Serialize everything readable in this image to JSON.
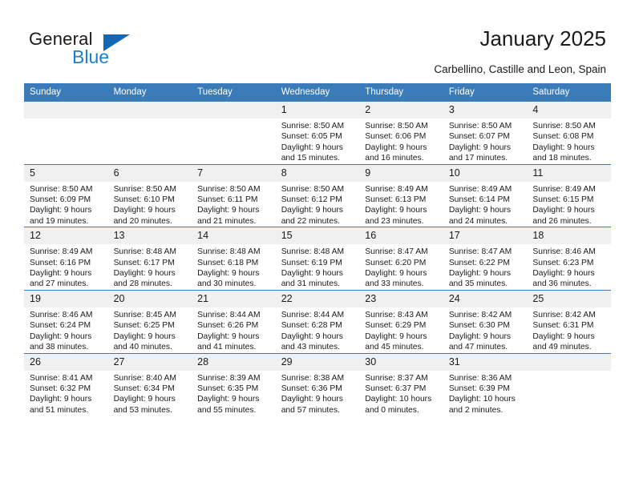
{
  "brand": {
    "name_part1": "General",
    "name_part2": "Blue",
    "triangle_color": "#1268b3",
    "blue_color": "#1a7fd4"
  },
  "header": {
    "title": "January 2025",
    "subtitle": "Carbellino, Castille and Leon, Spain",
    "header_bg": "#3a7cb9",
    "daynum_bg": "#f0f0f0"
  },
  "weekdays": [
    "Sunday",
    "Monday",
    "Tuesday",
    "Wednesday",
    "Thursday",
    "Friday",
    "Saturday"
  ],
  "weeks": [
    [
      {
        "day": "",
        "empty": true,
        "sunrise": "",
        "sunset": "",
        "daylight1": "",
        "daylight2": ""
      },
      {
        "day": "",
        "empty": true,
        "sunrise": "",
        "sunset": "",
        "daylight1": "",
        "daylight2": ""
      },
      {
        "day": "",
        "empty": true,
        "sunrise": "",
        "sunset": "",
        "daylight1": "",
        "daylight2": ""
      },
      {
        "day": "1",
        "empty": false,
        "sunrise": "Sunrise: 8:50 AM",
        "sunset": "Sunset: 6:05 PM",
        "daylight1": "Daylight: 9 hours",
        "daylight2": "and 15 minutes."
      },
      {
        "day": "2",
        "empty": false,
        "sunrise": "Sunrise: 8:50 AM",
        "sunset": "Sunset: 6:06 PM",
        "daylight1": "Daylight: 9 hours",
        "daylight2": "and 16 minutes."
      },
      {
        "day": "3",
        "empty": false,
        "sunrise": "Sunrise: 8:50 AM",
        "sunset": "Sunset: 6:07 PM",
        "daylight1": "Daylight: 9 hours",
        "daylight2": "and 17 minutes."
      },
      {
        "day": "4",
        "empty": false,
        "sunrise": "Sunrise: 8:50 AM",
        "sunset": "Sunset: 6:08 PM",
        "daylight1": "Daylight: 9 hours",
        "daylight2": "and 18 minutes."
      }
    ],
    [
      {
        "day": "5",
        "empty": false,
        "sunrise": "Sunrise: 8:50 AM",
        "sunset": "Sunset: 6:09 PM",
        "daylight1": "Daylight: 9 hours",
        "daylight2": "and 19 minutes."
      },
      {
        "day": "6",
        "empty": false,
        "sunrise": "Sunrise: 8:50 AM",
        "sunset": "Sunset: 6:10 PM",
        "daylight1": "Daylight: 9 hours",
        "daylight2": "and 20 minutes."
      },
      {
        "day": "7",
        "empty": false,
        "sunrise": "Sunrise: 8:50 AM",
        "sunset": "Sunset: 6:11 PM",
        "daylight1": "Daylight: 9 hours",
        "daylight2": "and 21 minutes."
      },
      {
        "day": "8",
        "empty": false,
        "sunrise": "Sunrise: 8:50 AM",
        "sunset": "Sunset: 6:12 PM",
        "daylight1": "Daylight: 9 hours",
        "daylight2": "and 22 minutes."
      },
      {
        "day": "9",
        "empty": false,
        "sunrise": "Sunrise: 8:49 AM",
        "sunset": "Sunset: 6:13 PM",
        "daylight1": "Daylight: 9 hours",
        "daylight2": "and 23 minutes."
      },
      {
        "day": "10",
        "empty": false,
        "sunrise": "Sunrise: 8:49 AM",
        "sunset": "Sunset: 6:14 PM",
        "daylight1": "Daylight: 9 hours",
        "daylight2": "and 24 minutes."
      },
      {
        "day": "11",
        "empty": false,
        "sunrise": "Sunrise: 8:49 AM",
        "sunset": "Sunset: 6:15 PM",
        "daylight1": "Daylight: 9 hours",
        "daylight2": "and 26 minutes."
      }
    ],
    [
      {
        "day": "12",
        "empty": false,
        "sunrise": "Sunrise: 8:49 AM",
        "sunset": "Sunset: 6:16 PM",
        "daylight1": "Daylight: 9 hours",
        "daylight2": "and 27 minutes."
      },
      {
        "day": "13",
        "empty": false,
        "sunrise": "Sunrise: 8:48 AM",
        "sunset": "Sunset: 6:17 PM",
        "daylight1": "Daylight: 9 hours",
        "daylight2": "and 28 minutes."
      },
      {
        "day": "14",
        "empty": false,
        "sunrise": "Sunrise: 8:48 AM",
        "sunset": "Sunset: 6:18 PM",
        "daylight1": "Daylight: 9 hours",
        "daylight2": "and 30 minutes."
      },
      {
        "day": "15",
        "empty": false,
        "sunrise": "Sunrise: 8:48 AM",
        "sunset": "Sunset: 6:19 PM",
        "daylight1": "Daylight: 9 hours",
        "daylight2": "and 31 minutes."
      },
      {
        "day": "16",
        "empty": false,
        "sunrise": "Sunrise: 8:47 AM",
        "sunset": "Sunset: 6:20 PM",
        "daylight1": "Daylight: 9 hours",
        "daylight2": "and 33 minutes."
      },
      {
        "day": "17",
        "empty": false,
        "sunrise": "Sunrise: 8:47 AM",
        "sunset": "Sunset: 6:22 PM",
        "daylight1": "Daylight: 9 hours",
        "daylight2": "and 35 minutes."
      },
      {
        "day": "18",
        "empty": false,
        "sunrise": "Sunrise: 8:46 AM",
        "sunset": "Sunset: 6:23 PM",
        "daylight1": "Daylight: 9 hours",
        "daylight2": "and 36 minutes."
      }
    ],
    [
      {
        "day": "19",
        "empty": false,
        "sunrise": "Sunrise: 8:46 AM",
        "sunset": "Sunset: 6:24 PM",
        "daylight1": "Daylight: 9 hours",
        "daylight2": "and 38 minutes."
      },
      {
        "day": "20",
        "empty": false,
        "sunrise": "Sunrise: 8:45 AM",
        "sunset": "Sunset: 6:25 PM",
        "daylight1": "Daylight: 9 hours",
        "daylight2": "and 40 minutes."
      },
      {
        "day": "21",
        "empty": false,
        "sunrise": "Sunrise: 8:44 AM",
        "sunset": "Sunset: 6:26 PM",
        "daylight1": "Daylight: 9 hours",
        "daylight2": "and 41 minutes."
      },
      {
        "day": "22",
        "empty": false,
        "sunrise": "Sunrise: 8:44 AM",
        "sunset": "Sunset: 6:28 PM",
        "daylight1": "Daylight: 9 hours",
        "daylight2": "and 43 minutes."
      },
      {
        "day": "23",
        "empty": false,
        "sunrise": "Sunrise: 8:43 AM",
        "sunset": "Sunset: 6:29 PM",
        "daylight1": "Daylight: 9 hours",
        "daylight2": "and 45 minutes."
      },
      {
        "day": "24",
        "empty": false,
        "sunrise": "Sunrise: 8:42 AM",
        "sunset": "Sunset: 6:30 PM",
        "daylight1": "Daylight: 9 hours",
        "daylight2": "and 47 minutes."
      },
      {
        "day": "25",
        "empty": false,
        "sunrise": "Sunrise: 8:42 AM",
        "sunset": "Sunset: 6:31 PM",
        "daylight1": "Daylight: 9 hours",
        "daylight2": "and 49 minutes."
      }
    ],
    [
      {
        "day": "26",
        "empty": false,
        "sunrise": "Sunrise: 8:41 AM",
        "sunset": "Sunset: 6:32 PM",
        "daylight1": "Daylight: 9 hours",
        "daylight2": "and 51 minutes."
      },
      {
        "day": "27",
        "empty": false,
        "sunrise": "Sunrise: 8:40 AM",
        "sunset": "Sunset: 6:34 PM",
        "daylight1": "Daylight: 9 hours",
        "daylight2": "and 53 minutes."
      },
      {
        "day": "28",
        "empty": false,
        "sunrise": "Sunrise: 8:39 AM",
        "sunset": "Sunset: 6:35 PM",
        "daylight1": "Daylight: 9 hours",
        "daylight2": "and 55 minutes."
      },
      {
        "day": "29",
        "empty": false,
        "sunrise": "Sunrise: 8:38 AM",
        "sunset": "Sunset: 6:36 PM",
        "daylight1": "Daylight: 9 hours",
        "daylight2": "and 57 minutes."
      },
      {
        "day": "30",
        "empty": false,
        "sunrise": "Sunrise: 8:37 AM",
        "sunset": "Sunset: 6:37 PM",
        "daylight1": "Daylight: 10 hours",
        "daylight2": "and 0 minutes."
      },
      {
        "day": "31",
        "empty": false,
        "sunrise": "Sunrise: 8:36 AM",
        "sunset": "Sunset: 6:39 PM",
        "daylight1": "Daylight: 10 hours",
        "daylight2": "and 2 minutes."
      },
      {
        "day": "",
        "empty": true,
        "sunrise": "",
        "sunset": "",
        "daylight1": "",
        "daylight2": ""
      }
    ]
  ]
}
